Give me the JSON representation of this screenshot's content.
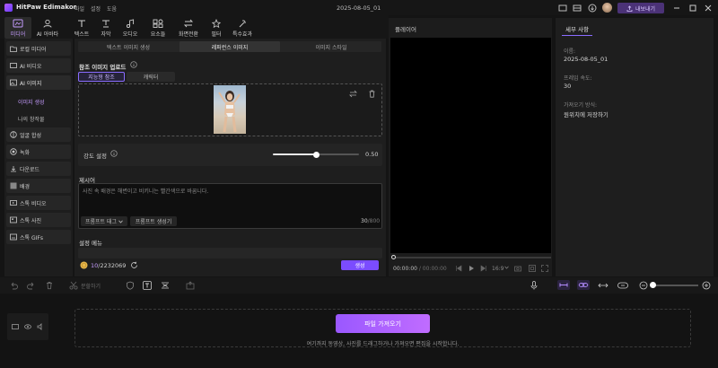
{
  "app": {
    "name": "HitPaw Edimakor",
    "menus": [
      "파일",
      "설정",
      "도움"
    ],
    "date": "2025-08-05_01",
    "export_label": "내보내기"
  },
  "toolbar": [
    {
      "label": "미디어",
      "icon": "media-icon"
    },
    {
      "label": "AI 아바타",
      "icon": "avatar-icon"
    },
    {
      "label": "텍스트",
      "icon": "text-icon"
    },
    {
      "label": "자막",
      "icon": "subtitle-icon"
    },
    {
      "label": "오디오",
      "icon": "audio-icon"
    },
    {
      "label": "요소들",
      "icon": "elements-icon"
    },
    {
      "label": "화면전환",
      "icon": "transition-icon"
    },
    {
      "label": "필터",
      "icon": "filter-icon"
    },
    {
      "label": "특수효과",
      "icon": "effects-icon"
    }
  ],
  "sidebar": {
    "items": [
      "로컬 미디어",
      "AI 비디오",
      "AI 이미지",
      "얼굴 합성",
      "녹화",
      "다운로드",
      "배경",
      "스톡 비디오",
      "스톡 사진",
      "스톡 GIFs"
    ],
    "subitems": [
      "이미지 생성",
      "나의 창작물"
    ]
  },
  "panel": {
    "tabs": [
      "텍스트 이미지 생성",
      "레퍼런스 이미지",
      "이미지 스타일"
    ],
    "upload_label": "참조 이미지 업로드",
    "subtabs": [
      "지능형 참조",
      "캐릭터"
    ],
    "strength_label": "강도 설정",
    "strength_value": "0.50",
    "strength_fraction": 0.5,
    "prompt_label": "제시어",
    "prompt_text": "사진 속 배경은 해변이고 비키니는 빨간색으로 바꿉니다.",
    "prompt_tag_btn": "프롬프트 태그",
    "prompt_gen_btn": "프롬프트 생성기",
    "char_count": "30",
    "char_max": "/800",
    "settings_label": "설정 메뉴",
    "credits_used": "10",
    "credits_total": "/2232069",
    "generate_label": "생성"
  },
  "player": {
    "title": "플레이어",
    "time_current": "00:00:00",
    "time_total": "/ 00:00:00",
    "ratio": "16:9"
  },
  "details": {
    "tab": "세부 사항",
    "fields": [
      {
        "label": "이름:",
        "value": "2025-08-05_01"
      },
      {
        "label": "프레임 속도:",
        "value": "30"
      },
      {
        "label": "가져오기 방식:",
        "value": "원위치에 저장하기"
      }
    ]
  },
  "timeline": {
    "split_label": "분할하기",
    "import_label": "파일 가져오기",
    "hint": "여기까지 동영상, 사진를 드래그하거나 가져오면 편집을 시작합니다."
  }
}
